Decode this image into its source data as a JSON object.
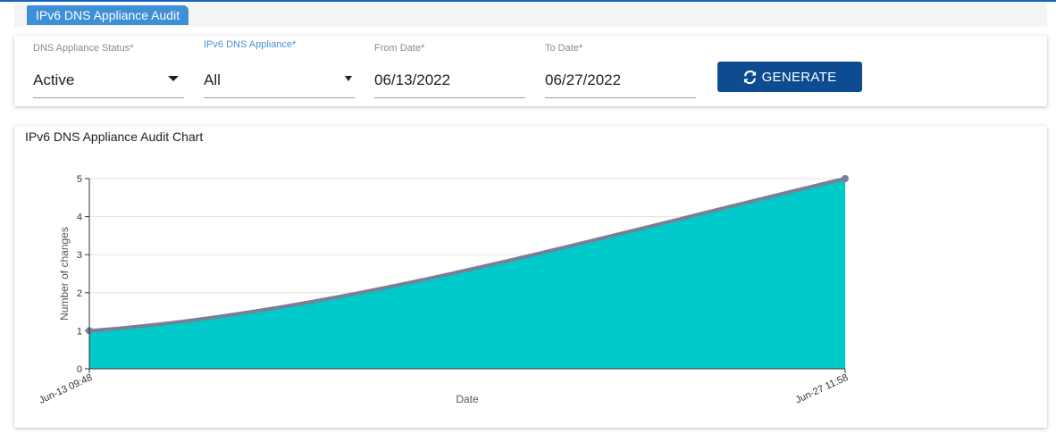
{
  "page": {
    "title_tab": "IPv6 DNS Appliance Audit"
  },
  "filters": {
    "status": {
      "label": "DNS Appliance Status*",
      "value": "Active"
    },
    "appliance": {
      "label": "IPv6 DNS Appliance*",
      "value": "All"
    },
    "from_date": {
      "label": "From Date*",
      "value": "06/13/2022"
    },
    "to_date": {
      "label": "To Date*",
      "value": "06/27/2022"
    },
    "generate_label": "GENERATE",
    "generate_icon": "refresh-icon"
  },
  "chart_card": {
    "title": "IPv6 DNS Appliance Audit Chart"
  },
  "colors": {
    "accent": "#0e4c92",
    "tab": "#3d8fd6",
    "area_fill": "#00c9c9",
    "line": "#7a7f96"
  },
  "chart_data": {
    "type": "area",
    "title": "IPv6 DNS Appliance Audit Chart",
    "xlabel": "Date",
    "ylabel": "Number of changes",
    "x": [
      "Jun-13 09:48",
      "Jun-27 11:58"
    ],
    "y": [
      1,
      5
    ],
    "ylim": [
      0,
      5
    ],
    "yticks": [
      0,
      1,
      2,
      3,
      4,
      5
    ],
    "grid": true,
    "legend": "none"
  }
}
